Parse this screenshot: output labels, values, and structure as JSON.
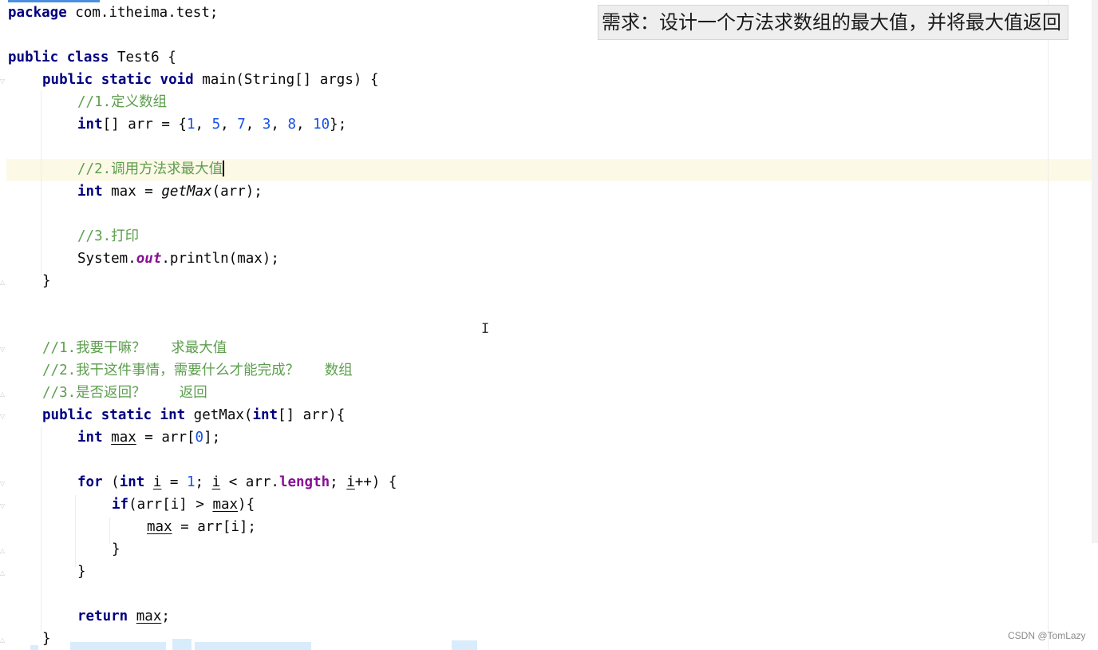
{
  "caption": "需求：设计一个方法求数组的最大值，并将最大值返回",
  "watermark": "CSDN @TomLazy",
  "code": {
    "line1": {
      "kw": "package",
      "rest": " com.itheima.test;"
    },
    "line2": {
      "kw1": "public",
      "kw2": "class",
      "rest": " Test6 {"
    },
    "line3": {
      "kw1": "public",
      "kw2": "static",
      "kw3": "void",
      "rest": " main(String[] args) {"
    },
    "line4": {
      "comment": "//1.定义数组"
    },
    "line5": {
      "kw": "int",
      "pre": "[] arr = {",
      "n1": "1",
      "n2": "5",
      "n3": "7",
      "n4": "3",
      "n5": "8",
      "n6": "10",
      "sep": ", ",
      "post": "};"
    },
    "line6": {
      "comment": "//2.调用方法求最大值"
    },
    "line7": {
      "kw": "int",
      "pre": " max = ",
      "call": "getMax",
      "post": "(arr);"
    },
    "line8": {
      "comment": "//3.打印"
    },
    "line9": {
      "cls": "System.",
      "field": "out",
      "post": ".println(max);"
    },
    "line10": {
      "text": "}"
    },
    "line11": {
      "comment": "//1.我要干嘛？   求最大值"
    },
    "line12": {
      "comment": "//2.我干这件事情，需要什么才能完成？   数组"
    },
    "line13": {
      "comment": "//3.是否返回？    返回"
    },
    "line14": {
      "kw1": "public",
      "kw2": "static",
      "kw3": "int",
      "mid": " getMax(",
      "kw4": "int",
      "post": "[] arr){"
    },
    "line15": {
      "kw": "int",
      "var": "max",
      "mid": " = arr[",
      "num": "0",
      "post": "];"
    },
    "line16": {
      "kw1": "for",
      "p1": " (",
      "kw2": "int",
      "v1": "i",
      "p2": " = ",
      "num": "1",
      "p3": "; ",
      "v2": "i",
      "p4": " < arr.",
      "prop": "length",
      "p5": "; ",
      "v3": "i",
      "p6": "++) {"
    },
    "line17": {
      "kw": "if",
      "pre": "(arr[i] > ",
      "var": "max",
      "post": "){"
    },
    "line18": {
      "var": "max",
      "post": " = arr[i];"
    },
    "line19": {
      "text": "}"
    },
    "line20": {
      "text": "}"
    },
    "line21": {
      "kw": "return",
      "var": "max",
      "post": ";"
    },
    "line22": {
      "text": "}"
    }
  }
}
